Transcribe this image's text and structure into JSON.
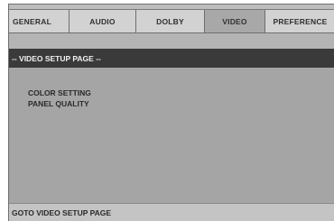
{
  "tabs": [
    {
      "label": "GENERAL",
      "active": false
    },
    {
      "label": "AUDIO",
      "active": false
    },
    {
      "label": "DOLBY",
      "active": false
    },
    {
      "label": "VIDEO",
      "active": true
    },
    {
      "label": "PREFERENCE",
      "active": false
    }
  ],
  "page_title": "-- VIDEO SETUP PAGE --",
  "menu_items": [
    "COLOR SETTING",
    "PANEL QUALITY"
  ],
  "status_text": "GOTO VIDEO SETUP PAGE"
}
